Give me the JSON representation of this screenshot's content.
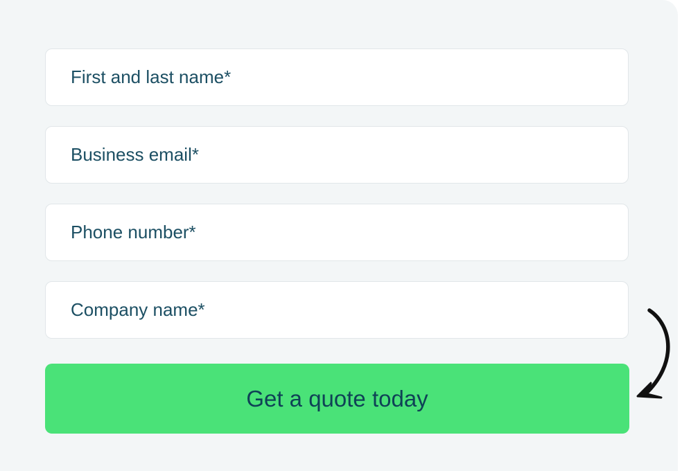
{
  "form": {
    "fields": [
      {
        "placeholder": "First and last name*",
        "value": ""
      },
      {
        "placeholder": "Business email*",
        "value": ""
      },
      {
        "placeholder": "Phone number*",
        "value": ""
      },
      {
        "placeholder": "Company name*",
        "value": ""
      }
    ],
    "submit_label": "Get a quote today"
  },
  "decor": {
    "arrow_icon": "curved-arrow-down-left-icon"
  },
  "colors": {
    "panel_bg": "#f3f6f7",
    "field_border": "#e1e6e9",
    "text": "#1c4f63",
    "button_bg": "#4ae278",
    "button_text": "#0f4256",
    "arrow": "#111111"
  }
}
